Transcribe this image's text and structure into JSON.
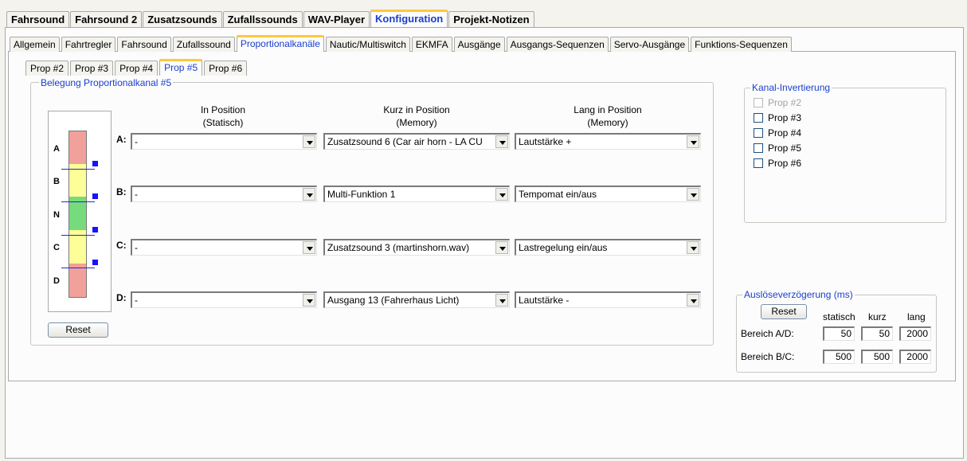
{
  "main_tabs": [
    "Fahrsound",
    "Fahrsound 2",
    "Zusatzsounds",
    "Zufallssounds",
    "WAV-Player",
    "Konfiguration",
    "Projekt-Notizen"
  ],
  "main_tab_active": "Konfiguration",
  "config_tabs": [
    "Allgemein",
    "Fahrtregler",
    "Fahrsound",
    "Zufallssound",
    "Proportionalkanäle",
    "Nautic/Multiswitch",
    "EKMFA",
    "Ausgänge",
    "Ausgangs-Sequenzen",
    "Servo-Ausgänge",
    "Funktions-Sequenzen"
  ],
  "config_tab_active": "Proportionalkanäle",
  "prop_tabs": [
    "Prop #2",
    "Prop #3",
    "Prop #4",
    "Prop #5",
    "Prop #6"
  ],
  "prop_tab_active": "Prop #5",
  "assignment": {
    "title": "Belegung Proportionalkanal #5",
    "slider_letters": [
      "A",
      "B",
      "N",
      "C",
      "D"
    ],
    "colors": {
      "red": "#f2a09a",
      "yellow": "#fefe98",
      "green": "#76db7c"
    },
    "columns": [
      {
        "title": "In Position",
        "subtitle": "(Statisch)"
      },
      {
        "title": "Kurz in Position",
        "subtitle": "(Memory)"
      },
      {
        "title": "Lang in Position",
        "subtitle": "(Memory)"
      }
    ],
    "rows": [
      {
        "label": "A:",
        "static": "-",
        "short": "Zusatzsound 6 (Car air horn - LA CU",
        "long": "Lautstärke +"
      },
      {
        "label": "B:",
        "static": "-",
        "short": "Multi-Funktion 1",
        "long": "Tempomat ein/aus"
      },
      {
        "label": "C:",
        "static": "-",
        "short": "Zusatzsound 3 (martinshorn.wav)",
        "long": "Lastregelung ein/aus"
      },
      {
        "label": "D:",
        "static": "-",
        "short": "Ausgang 13 (Fahrerhaus Licht)",
        "long": "Lautstärke -"
      }
    ],
    "reset_label": "Reset"
  },
  "inversion": {
    "title": "Kanal-Invertierung",
    "items": [
      {
        "label": "Prop #2",
        "checked": false,
        "disabled": true
      },
      {
        "label": "Prop #3",
        "checked": false,
        "disabled": false
      },
      {
        "label": "Prop #4",
        "checked": false,
        "disabled": false
      },
      {
        "label": "Prop #5",
        "checked": false,
        "disabled": false
      },
      {
        "label": "Prop #6",
        "checked": false,
        "disabled": false
      }
    ]
  },
  "delay": {
    "title": "Auslöseverzögerung (ms)",
    "reset_label": "Reset",
    "headers": [
      "statisch",
      "kurz",
      "lang"
    ],
    "rows": [
      {
        "label": "Bereich A/D:",
        "values": [
          "50",
          "50",
          "2000"
        ]
      },
      {
        "label": "Bereich B/C:",
        "values": [
          "500",
          "500",
          "2000"
        ]
      }
    ]
  }
}
